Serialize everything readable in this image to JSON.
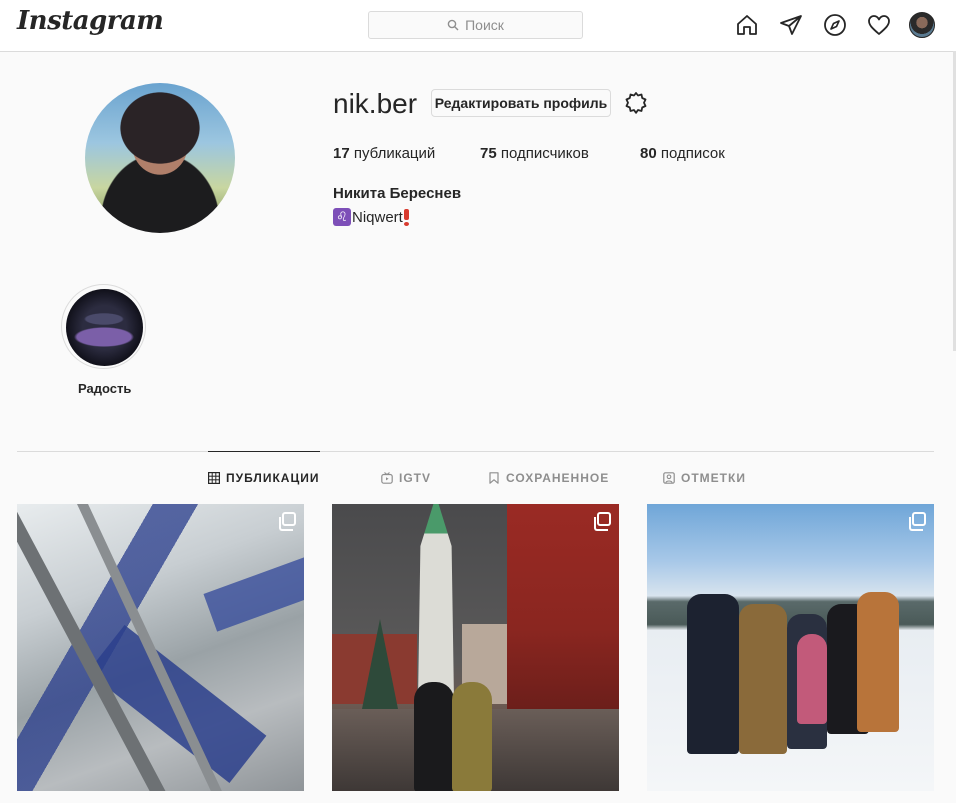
{
  "nav": {
    "logo": "Instagram",
    "search_placeholder": "Поиск",
    "icons": [
      "home-icon",
      "direct-icon",
      "explore-icon",
      "activity-heart-icon",
      "profile-avatar"
    ]
  },
  "profile": {
    "username": "nik.ber",
    "edit_button": "Редактировать профиль",
    "stats": {
      "posts_count": "17",
      "posts_label": "публикаций",
      "followers_count": "75",
      "followers_label": "подписчиков",
      "following_count": "80",
      "following_label": "подписок"
    },
    "full_name": "Никита Береснев",
    "bio_text": "Niqwert",
    "bio_emoji": "♌"
  },
  "highlights": [
    {
      "label": "Радость"
    }
  ],
  "tabs": [
    {
      "label": "ПУБЛИКАЦИИ",
      "icon": "grid-icon",
      "active": true
    },
    {
      "label": "IGTV",
      "icon": "igtv-icon",
      "active": false
    },
    {
      "label": "СОХРАНЕННОЕ",
      "icon": "bookmark-icon",
      "active": false
    },
    {
      "label": "ОТМЕТКИ",
      "icon": "tagged-icon",
      "active": false
    }
  ],
  "posts": [
    {
      "type": "carousel"
    },
    {
      "type": "carousel"
    },
    {
      "type": "carousel"
    }
  ],
  "colors": {
    "background": "#fafafa",
    "border": "#dbdbdb",
    "text": "#262626",
    "muted": "#8e8e8e"
  }
}
